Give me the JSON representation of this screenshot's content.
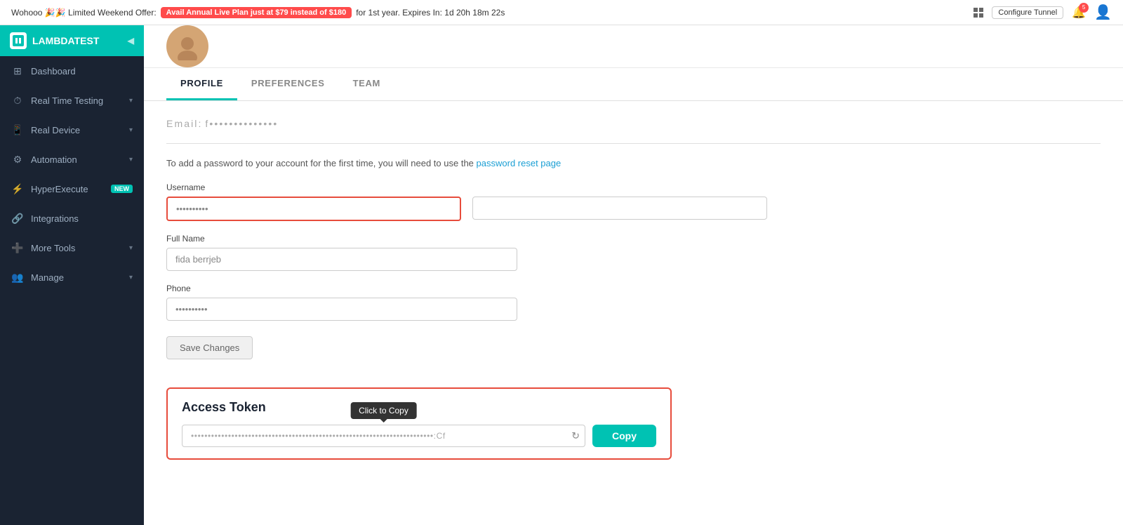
{
  "banner": {
    "text_before": "Wohooo 🎉🎉 Limited Weekend Offer:",
    "offer_btn": "Avail Annual Live Plan just at $79 instead of $180",
    "text_after": "for 1st year. Expires In: 1d 20h 18m 22s",
    "configure_tunnel": "Configure Tunnel",
    "notif_count": "5"
  },
  "sidebar": {
    "logo": "LAMBDATEST",
    "items": [
      {
        "label": "Dashboard",
        "icon": "⊞"
      },
      {
        "label": "Real Time Testing",
        "icon": "⏱",
        "has_arrow": true
      },
      {
        "label": "Real Device",
        "icon": "📱",
        "has_arrow": true
      },
      {
        "label": "Automation",
        "icon": "⚙",
        "has_arrow": true
      },
      {
        "label": "HyperExecute",
        "icon": "⚡",
        "badge": "NEW"
      },
      {
        "label": "Integrations",
        "icon": "🔗"
      },
      {
        "label": "More Tools",
        "icon": "➕",
        "has_arrow": true
      },
      {
        "label": "Manage",
        "icon": "👥",
        "has_arrow": true
      }
    ]
  },
  "profile": {
    "tabs": [
      "PROFILE",
      "PREFERENCES",
      "TEAM"
    ],
    "active_tab": "PROFILE",
    "email_label": "Email:",
    "email_value": "f••••••••••••••",
    "password_notice": "To add a password to your account for the first time, you will need to use the",
    "password_link": "password reset page",
    "username_label": "Username",
    "username_value": "••••••••••",
    "full_name_label": "Full Name",
    "full_name_value": "fida berrjeb",
    "phone_label": "Phone",
    "phone_value": "••••••••••",
    "save_btn": "Save Changes",
    "access_token_title": "Access Token",
    "token_value": "••••••••••••••••••••••••••••••••••••••••••••••••••••••••••••••••••••••••:Cf",
    "tooltip_text": "Click to Copy",
    "copy_btn": "Copy"
  }
}
